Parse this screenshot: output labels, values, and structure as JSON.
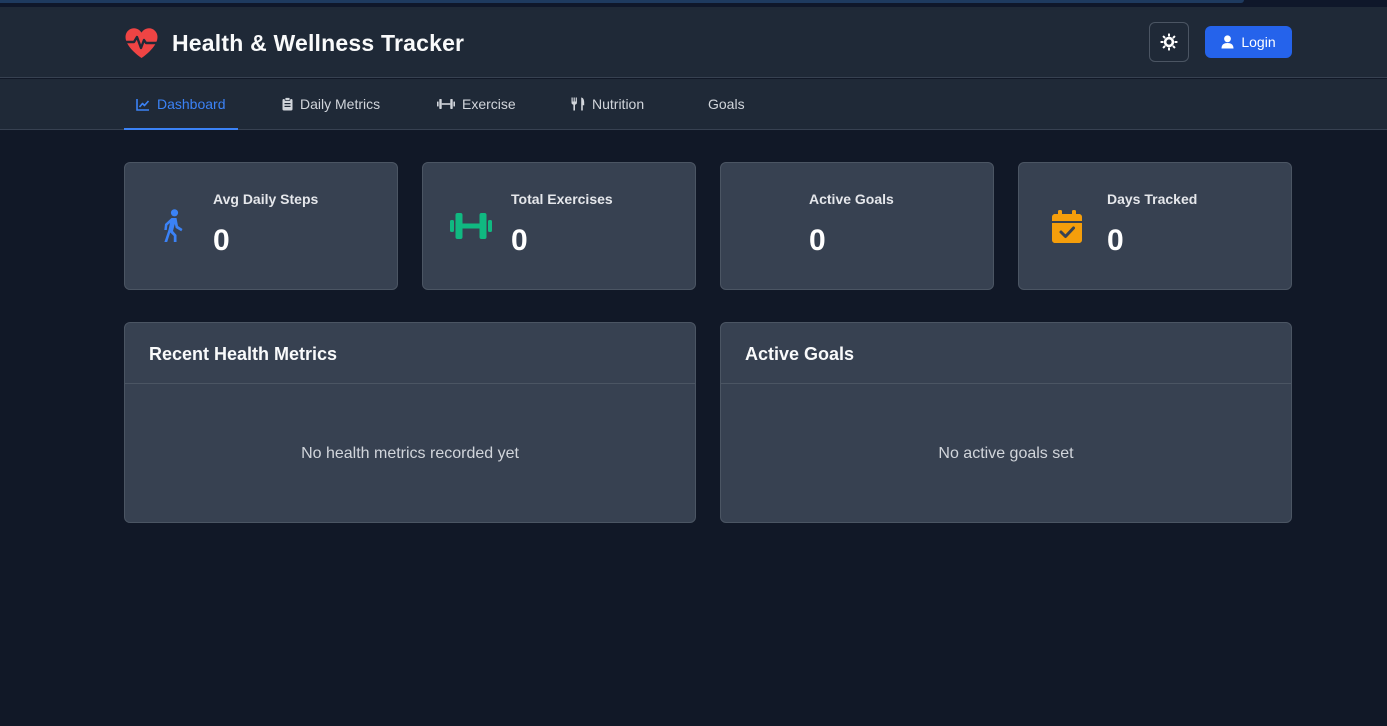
{
  "app": {
    "title": "Health & Wellness Tracker",
    "login_label": "Login"
  },
  "nav": {
    "items": [
      {
        "label": "Dashboard",
        "icon": "chart-line-icon",
        "active": true
      },
      {
        "label": "Daily Metrics",
        "icon": "clipboard-icon",
        "active": false
      },
      {
        "label": "Exercise",
        "icon": "dumbbell-icon",
        "active": false
      },
      {
        "label": "Nutrition",
        "icon": "utensils-icon",
        "active": false
      },
      {
        "label": "Goals",
        "icon": "",
        "active": false
      }
    ]
  },
  "stats": [
    {
      "label": "Avg Daily Steps",
      "value": "0",
      "icon": "walking-icon",
      "color": "#3b82f6"
    },
    {
      "label": "Total Exercises",
      "value": "0",
      "icon": "dumbbell-icon",
      "color": "#10b981"
    },
    {
      "label": "Active Goals",
      "value": "0",
      "icon": "",
      "color": ""
    },
    {
      "label": "Days Tracked",
      "value": "0",
      "icon": "calendar-check-icon",
      "color": "#f59e0b"
    }
  ],
  "panels": {
    "metrics": {
      "title": "Recent Health Metrics",
      "empty": "No health metrics recorded yet"
    },
    "goals": {
      "title": "Active Goals",
      "empty": "No active goals set"
    }
  },
  "colors": {
    "background": "#111827",
    "header": "#1f2937",
    "card": "#374151",
    "accent": "#3b82f6",
    "brand_heart": "#ef4444",
    "login_button": "#2563eb"
  }
}
